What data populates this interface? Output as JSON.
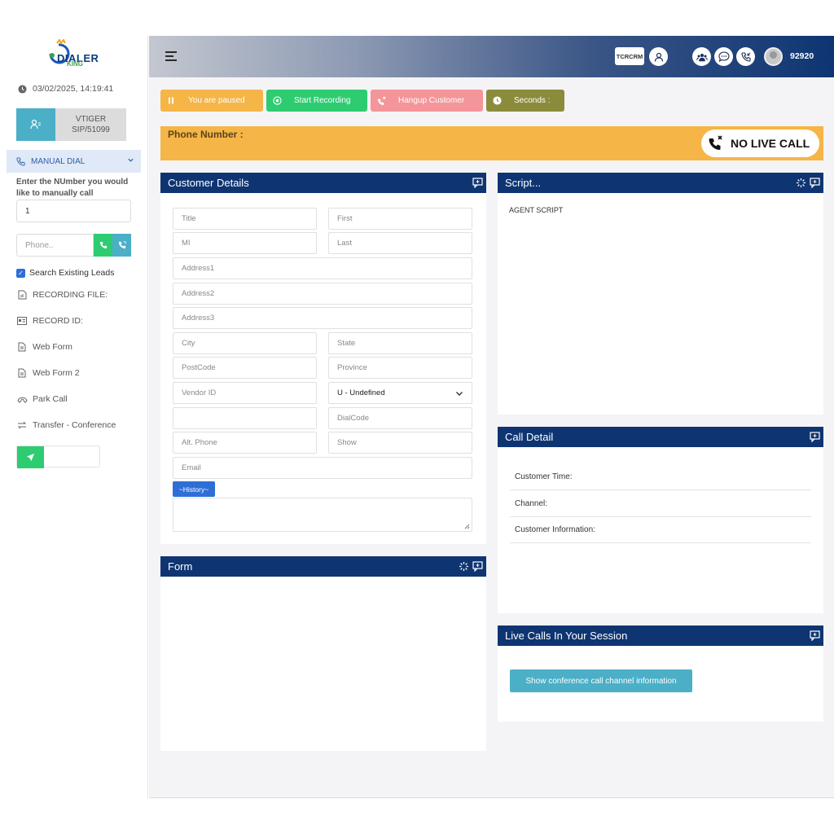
{
  "brand": {
    "logo_main": "DIALER",
    "logo_sub": "KING"
  },
  "sidebar": {
    "datetime": "03/02/2025, 14:19:41",
    "campaign": {
      "name": "VTIGER",
      "sip": "SIP/51099"
    },
    "manual_dial_label": "MANUAL DIAL",
    "manual_dial_help": "Enter the NUmber you would like to manually call",
    "manual_dial_value": "1",
    "phone_placeholder": "Phone..",
    "search_leads_label": "Search Existing Leads",
    "items": [
      {
        "label": "RECORDING FILE:",
        "icon": "audio-file-icon"
      },
      {
        "label": "RECORD ID:",
        "icon": "id-card-icon"
      },
      {
        "label": "Web Form",
        "icon": "document-icon"
      },
      {
        "label": "Web Form 2",
        "icon": "document-icon"
      },
      {
        "label": "Park Call",
        "icon": "park-call-icon"
      },
      {
        "label": "Transfer - Conference",
        "icon": "transfer-icon"
      }
    ]
  },
  "header": {
    "crm_label": "TCRCRM",
    "user_id": "92920"
  },
  "actions": {
    "paused": "You are paused",
    "start_recording": "Start Recording",
    "hangup": "Hangup Customer",
    "seconds": "Seconds :"
  },
  "call_bar": {
    "phone_label": "Phone Number :",
    "status": "NO LIVE CALL"
  },
  "customer_details": {
    "title": "Customer Details",
    "fields": {
      "title": "Title",
      "first": "First",
      "mi": "MI",
      "last": "Last",
      "address1": "Address1",
      "address2": "Address2",
      "address3": "Address3",
      "city": "City",
      "state": "State",
      "postcode": "PostCode",
      "province": "Province",
      "vendor_id": "Vendor ID",
      "gender": "U - Undefined",
      "dialcode": "DialCode",
      "alt_phone": "Alt. Phone",
      "show": "Show",
      "email": "Email"
    },
    "history_label": "~History~"
  },
  "script": {
    "title": "Script...",
    "content": "AGENT SCRIPT"
  },
  "form": {
    "title": "Form"
  },
  "call_detail": {
    "title": "Call Detail",
    "rows": [
      "Customer Time:",
      "Channel:",
      "Customer Information:"
    ]
  },
  "live_calls": {
    "title": "Live Calls In Your Session",
    "button": "Show conference call channel information"
  },
  "colors": {
    "navy": "#0e3572",
    "teal": "#4aafc7",
    "green": "#2ecc71",
    "paused": "#f5b547",
    "hangup": "#f4959a",
    "seconds": "#8b8b3c"
  }
}
